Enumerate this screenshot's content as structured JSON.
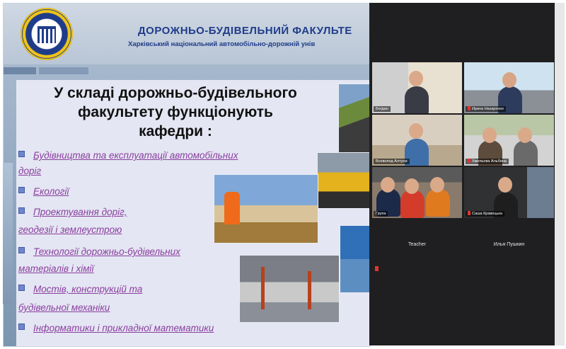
{
  "slide": {
    "header_title": "ДОРОЖНЬО-БУДІВЕЛЬНИЙ ФАКУЛЬТЕ",
    "header_subtitle": "Харківський національний автомобільно-дорожній унів",
    "heading_lines": [
      "У складі дорожньо-будівельного",
      "факультету  функціонують",
      "кафедри :"
    ],
    "departments": [
      {
        "line1": "Будівництва та експлуатації автомобільних",
        "line2": "доріг"
      },
      {
        "line1": "Екології",
        "line2": ""
      },
      {
        "line1": "Проектування доріг,",
        "line2": "геодезії і землеустрою"
      },
      {
        "line1": "Технології дорожньо-будівельних",
        "line2": "матеріалів і хімії"
      },
      {
        "line1": "Мостів, конструкцій та",
        "line2": "будівельної механіки"
      },
      {
        "line1": "Інформатики і прикладної математики",
        "line2": ""
      }
    ]
  },
  "zoom": {
    "participants": [
      {
        "name": "Богдан",
        "muted": false
      },
      {
        "name": "Ирина Назаренко",
        "muted": true
      },
      {
        "name": "Всеволод Алтуни",
        "muted": false
      },
      {
        "name": "Хмельова Альбина",
        "muted": true
      },
      {
        "name": "Група",
        "muted": false
      },
      {
        "name": "Саша Кравецька",
        "muted": true
      },
      {
        "name": "Teacher",
        "muted": false
      },
      {
        "name": "Илья Пушкин",
        "muted": false
      }
    ]
  }
}
